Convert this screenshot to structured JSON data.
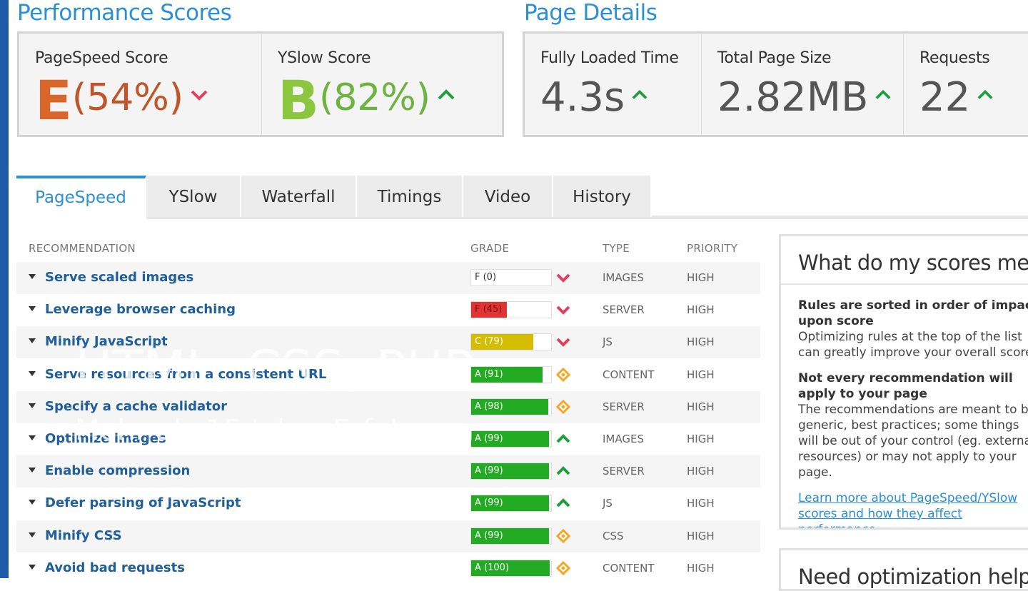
{
  "performance": {
    "title": "Performance Scores",
    "pagespeed": {
      "label": "PageSpeed Score",
      "grade": "E",
      "percent": "(54%)",
      "trend": "down",
      "color": "#d9662b"
    },
    "yslow": {
      "label": "YSlow Score",
      "grade": "B",
      "percent": "(82%)",
      "trend": "up",
      "color": "#8cc63f"
    }
  },
  "details": {
    "title": "Page Details",
    "loaded": {
      "label": "Fully Loaded Time",
      "value": "4.3s",
      "trend": "up"
    },
    "size": {
      "label": "Total Page Size",
      "value": "2.82MB",
      "trend": "up"
    },
    "requests": {
      "label": "Requests",
      "value": "22",
      "trend": "up"
    }
  },
  "tabs": [
    "PageSpeed",
    "YSlow",
    "Waterfall",
    "Timings",
    "Video",
    "History"
  ],
  "table": {
    "headers": {
      "recommendation": "RECOMMENDATION",
      "grade": "GRADE",
      "type": "TYPE",
      "priority": "PRIORITY"
    },
    "rows": [
      {
        "name": "Serve scaled images",
        "grade": "F (0)",
        "score": 0,
        "trend": "down",
        "type": "IMAGES",
        "priority": "HIGH"
      },
      {
        "name": "Leverage browser caching",
        "grade": "F (45)",
        "score": 45,
        "trend": "down",
        "type": "SERVER",
        "priority": "HIGH"
      },
      {
        "name": "Minify JavaScript",
        "grade": "C (79)",
        "score": 79,
        "trend": "down",
        "type": "JS",
        "priority": "HIGH"
      },
      {
        "name": "Serve resources from a consistent URL",
        "grade": "A (91)",
        "score": 91,
        "trend": "neutral",
        "type": "CONTENT",
        "priority": "HIGH"
      },
      {
        "name": "Specify a cache validator",
        "grade": "A (98)",
        "score": 98,
        "trend": "neutral",
        "type": "SERVER",
        "priority": "HIGH"
      },
      {
        "name": "Optimize images",
        "grade": "A (99)",
        "score": 99,
        "trend": "up",
        "type": "IMAGES",
        "priority": "HIGH"
      },
      {
        "name": "Enable compression",
        "grade": "A (99)",
        "score": 99,
        "trend": "up",
        "type": "SERVER",
        "priority": "HIGH"
      },
      {
        "name": "Defer parsing of JavaScript",
        "grade": "A (99)",
        "score": 99,
        "trend": "up",
        "type": "JS",
        "priority": "HIGH"
      },
      {
        "name": "Minify CSS",
        "grade": "A (99)",
        "score": 99,
        "trend": "neutral",
        "type": "CSS",
        "priority": "HIGH"
      },
      {
        "name": "Avoid bad requests",
        "grade": "A (100)",
        "score": 100,
        "trend": "neutral",
        "type": "CONTENT",
        "priority": "HIGH"
      }
    ]
  },
  "sidebar": {
    "title": "What do my scores mean?",
    "block1_head": "Rules are sorted in order of impact upon score",
    "block1_text": "Optimizing rules at the top of the list can greatly improve your overall score.",
    "block2_head": "Not every recommendation will apply to your page",
    "block2_text": "The recommendations are meant to be generic, best practices; some things will be out of your control (eg. external resources) or may not apply to your page.",
    "link": "Learn more about PageSpeed/YSlow scores and how they affect performance.",
    "box2_title": "Need optimization help?"
  },
  "overlay": {
    "line1": "HTML, CSS, PHP",
    "line2": "Mehr als 15 Jahre Erfahrung"
  },
  "colors": {
    "accent": "#2a8fd6",
    "grade_a": "#22aa22",
    "grade_c": "#d4bc00",
    "grade_f": "#e03333",
    "up": "#1c9e3a",
    "down": "#e0405a",
    "neutral": "#f5a623"
  }
}
